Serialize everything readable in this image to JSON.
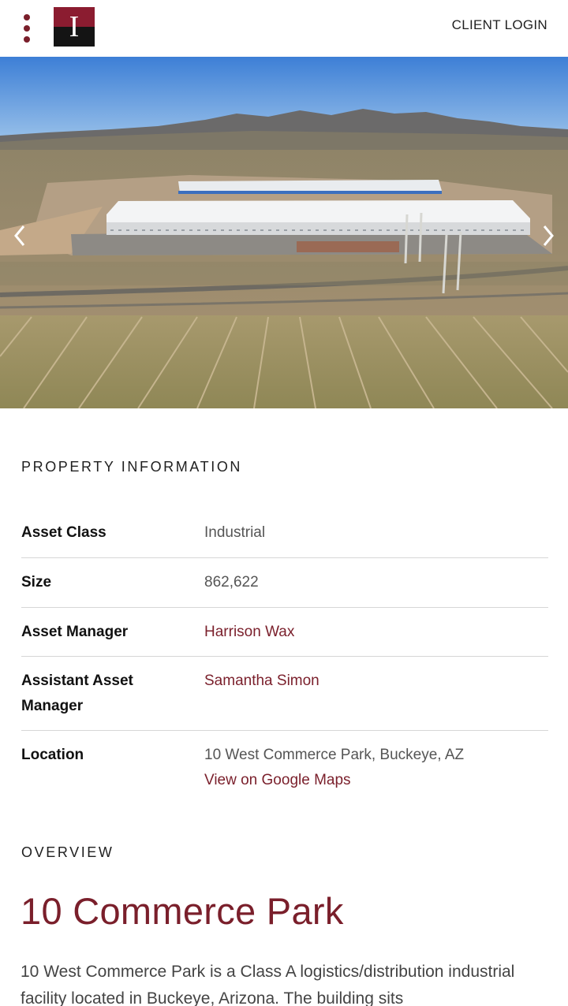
{
  "header": {
    "logo_letter": "I",
    "client_login": "CLIENT LOGIN"
  },
  "hero": {
    "prev_icon": "chevron-left-icon",
    "next_icon": "chevron-right-icon"
  },
  "property_info": {
    "title": "PROPERTY INFORMATION",
    "rows": [
      {
        "label": "Asset Class",
        "value": "Industrial"
      },
      {
        "label": "Size",
        "value": "862,622"
      },
      {
        "label": "Asset Manager",
        "value": "Harrison Wax"
      },
      {
        "label": "Assistant Asset Manager",
        "value": "Samantha Simon"
      },
      {
        "label": "Location",
        "value": "10 West Commerce Park, Buckeye, AZ",
        "link": "View on Google Maps"
      }
    ]
  },
  "overview": {
    "title": "OVERVIEW",
    "heading": "10 Commerce Park",
    "text": "10 West Commerce Park is a Class A logistics/distribution industrial facility located in Buckeye, Arizona. The building sits"
  },
  "colors": {
    "accent": "#7a1f2b",
    "logo_top": "#8b1c30",
    "logo_bottom": "#141414"
  }
}
